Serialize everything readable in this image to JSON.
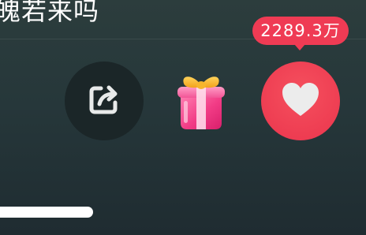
{
  "video": {
    "title": "魄若来吗"
  },
  "actions": {
    "share_icon": "share-icon",
    "gift_icon": "gift-icon",
    "like_icon": "heart-icon",
    "like_count": "2289.3万"
  },
  "colors": {
    "like_accent": "#ef3b54",
    "background": "#26373a",
    "share_button_bg": "#1b2628"
  }
}
